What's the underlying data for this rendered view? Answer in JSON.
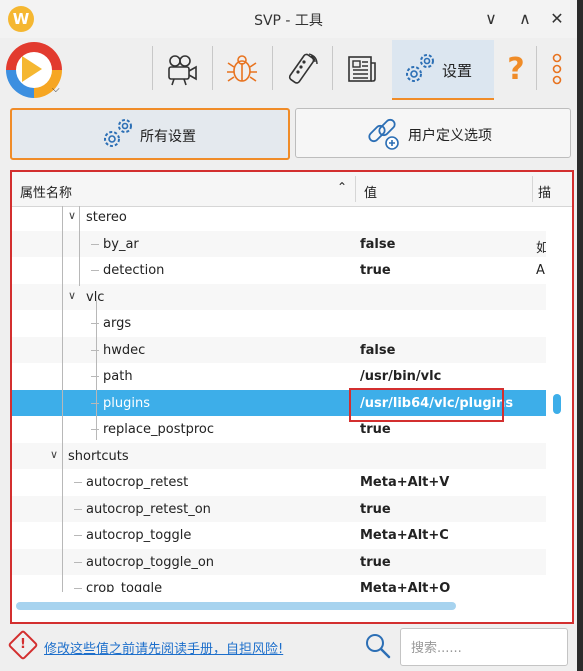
{
  "window": {
    "title": "SVP - 工具",
    "logo_letter": "W",
    "minimize_glyph": "∨",
    "maximize_glyph": "∧",
    "close_glyph": "✕"
  },
  "toolbar": {
    "items": [
      {
        "icon": "camera-icon"
      },
      {
        "icon": "bug-icon"
      },
      {
        "icon": "remote-control-icon"
      },
      {
        "icon": "newspaper-icon"
      }
    ],
    "settings_label": "设置",
    "help_glyph": "?",
    "more_icon": "more-icon"
  },
  "subtabs": {
    "all_settings": "所有设置",
    "user_options": "用户定义选项"
  },
  "table": {
    "headers": {
      "name": "属性名称",
      "value": "值",
      "desc": "描"
    },
    "rows": [
      {
        "name": "stereo",
        "value": "",
        "desc": "",
        "level": 2,
        "expand": "open"
      },
      {
        "name": "by_ar",
        "value": "false",
        "desc": "如",
        "level": 3
      },
      {
        "name": "detection",
        "value": "true",
        "desc": "Au",
        "level": 3
      },
      {
        "name": "vlc",
        "value": "",
        "desc": "",
        "level": 2,
        "expand": "open"
      },
      {
        "name": "args",
        "value": "",
        "desc": "",
        "level": 3
      },
      {
        "name": "hwdec",
        "value": "false",
        "desc": "",
        "level": 3
      },
      {
        "name": "path",
        "value": "/usr/bin/vlc",
        "desc": "",
        "level": 3
      },
      {
        "name": "plugins",
        "value": "/usr/lib64/vlc/plugins",
        "desc": "",
        "level": 3,
        "selected": true
      },
      {
        "name": "replace_postproc",
        "value": "true",
        "desc": "",
        "level": 3
      },
      {
        "name": "shortcuts",
        "value": "",
        "desc": "",
        "level": 1,
        "expand": "open"
      },
      {
        "name": "autocrop_retest",
        "value": "Meta+Alt+V",
        "desc": "",
        "level": 2
      },
      {
        "name": "autocrop_retest_on",
        "value": "true",
        "desc": "",
        "level": 2
      },
      {
        "name": "autocrop_toggle",
        "value": "Meta+Alt+C",
        "desc": "",
        "level": 2
      },
      {
        "name": "autocrop_toggle_on",
        "value": "true",
        "desc": "",
        "level": 2
      },
      {
        "name": "crop_toggle",
        "value": "Meta+Alt+O",
        "desc": "",
        "level": 2
      }
    ]
  },
  "status": {
    "warning_text": "修改这些值之前请先阅读手册，自担风险!",
    "search_placeholder": "搜索......"
  },
  "colors": {
    "accent": "#f08c28",
    "selection": "#3daee9",
    "highlight_border": "#d32f2f",
    "link": "#1d6fcb"
  }
}
